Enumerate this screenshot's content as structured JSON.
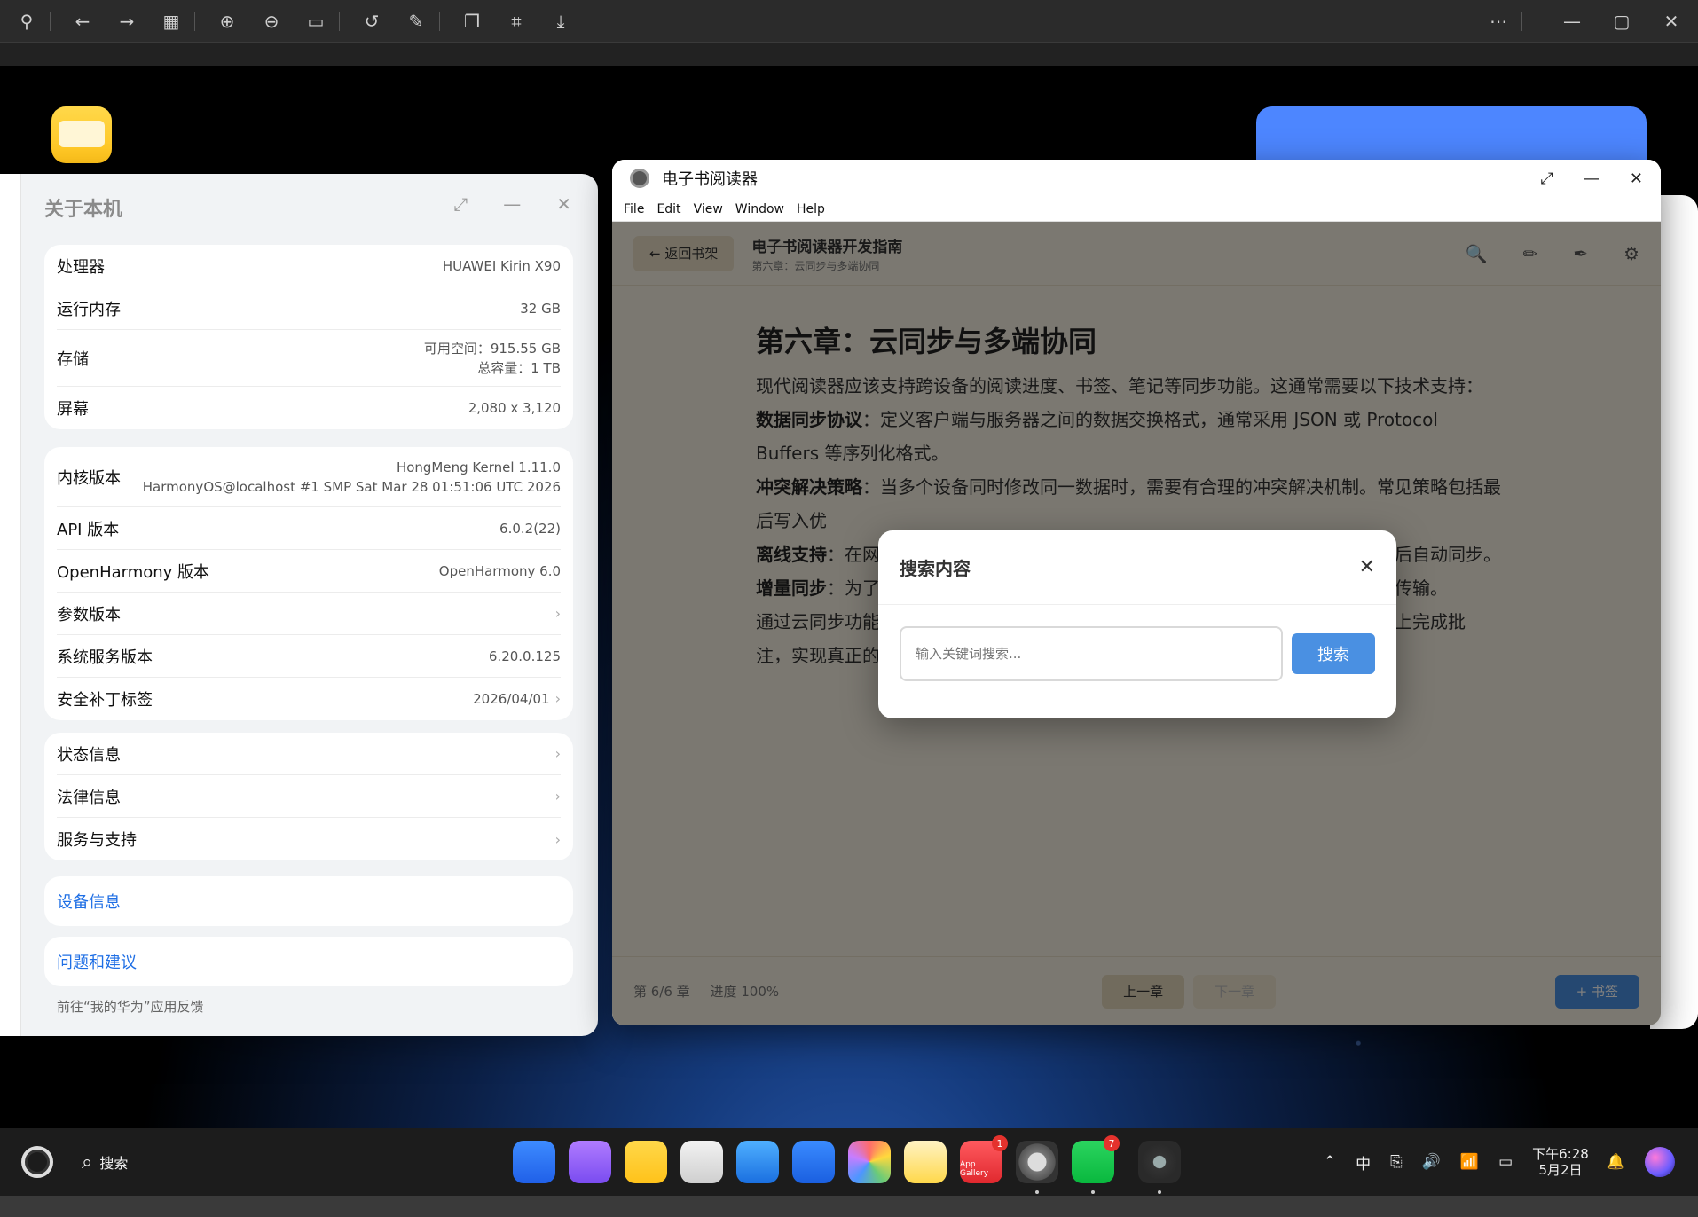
{
  "about": {
    "title": "关于本机",
    "hardware": [
      {
        "k": "处理器",
        "v": "HUAWEI Kirin X90"
      },
      {
        "k": "运行内存",
        "v": "32 GB"
      },
      {
        "k": "存储",
        "v": "可用空间：915.55 GB",
        "v2": "总容量：1 TB"
      },
      {
        "k": "屏幕",
        "v": "2,080 x 3,120"
      }
    ],
    "software": [
      {
        "k": "内核版本",
        "v": "HongMeng Kernel 1.11.0",
        "v2": "HarmonyOS@localhost #1 SMP Sat Mar 28 01:51:06 UTC 2026"
      },
      {
        "k": "API 版本",
        "v": "6.0.2(22)"
      },
      {
        "k": "OpenHarmony 版本",
        "v": "OpenHarmony 6.0"
      },
      {
        "k": "参数版本",
        "v": ""
      },
      {
        "k": "系统服务版本",
        "v": "6.20.0.125"
      },
      {
        "k": "安全补丁标签",
        "v": "2026/04/01"
      }
    ],
    "info": [
      {
        "k": "状态信息"
      },
      {
        "k": "法律信息"
      },
      {
        "k": "服务与支持"
      }
    ],
    "device_info": "设备信息",
    "feedback": "问题和建议",
    "feedback_hint": "前往“我的华为”应用反馈"
  },
  "reader": {
    "window_title": "电子书阅读器",
    "menu": [
      "File",
      "Edit",
      "View",
      "Window",
      "Help"
    ],
    "back_label": "← 返回书架",
    "book_title": "电子书阅读器开发指南",
    "book_subtitle": "第六章：云同步与多端协同",
    "chapter_title": "第六章：云同步与多端协同",
    "p1": "现代阅读器应该支持跨设备的阅读进度、书签、笔记等同步功能。这通常需要以下技术支持：",
    "p2_k": "数据同步协议",
    "p2_v": "：定义客户端与服务器之间的数据交换格式，通常采用 JSON 或 Protocol Buffers 等序列化格式。",
    "p3_k": "冲突解决策略",
    "p3_v": "：当多个设备同时修改同一数据时，需要有合理的冲突解决机制。常见策略包括最后写入优",
    "p4_k": "离线支持",
    "p4_v": "：在网",
    "p4_tail": "后自动同步。",
    "p5_k": "增量同步",
    "p5_v": "：为了",
    "p5_tail": "传输。",
    "p6": "通过云同步功能",
    "p6_tail": "端上完成批",
    "p7": "注，实现真正的",
    "footer_chapter": "第 6/6 章",
    "footer_progress": "进度 100%",
    "prev": "上一章",
    "next": "下一章",
    "bookmark": "+ 书签"
  },
  "dialog": {
    "title": "搜索内容",
    "placeholder": "输入关键词搜索...",
    "button": "搜索"
  },
  "taskbar": {
    "search": "搜索",
    "ime": "中",
    "time": "下午6:28",
    "date": "5月2日",
    "appgallery_badge": "1",
    "wechat_badge": "7",
    "appgallery_label": "App Gallery"
  }
}
